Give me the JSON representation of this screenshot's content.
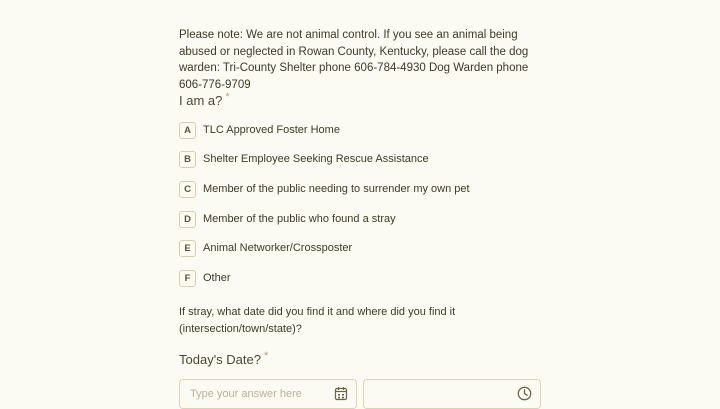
{
  "notice": "Please note: We are not animal control. If you see an animal being abused or neglected in Rowan County, Kentucky, please call the dog warden: Tri-County Shelter phone 606-784-4930 Dog Warden phone 606-776-9709",
  "question_role": {
    "title": "I am a?",
    "required_mark": "*",
    "choices": [
      {
        "key": "A",
        "label": "TLC Approved Foster Home"
      },
      {
        "key": "B",
        "label": "Shelter Employee Seeking Rescue Assistance"
      },
      {
        "key": "C",
        "label": "Member of the public needing to surrender my own pet"
      },
      {
        "key": "D",
        "label": "Member of the public who found a stray"
      },
      {
        "key": "E",
        "label": "Animal Networker/Crossposter"
      },
      {
        "key": "F",
        "label": "Other"
      }
    ]
  },
  "question_stray": {
    "title": "If stray, what date did you find it and where did you find it (intersection/town/state)?"
  },
  "question_date": {
    "title": "Today's Date?",
    "required_mark": "*",
    "date_placeholder": "Type your answer here",
    "time_placeholder": ""
  },
  "icons": {
    "date": "calendar-icon",
    "time": "clock-icon"
  },
  "colors": {
    "background": "#fbfbf3",
    "border": "#d9cfa6",
    "text": "#3d3a25"
  }
}
